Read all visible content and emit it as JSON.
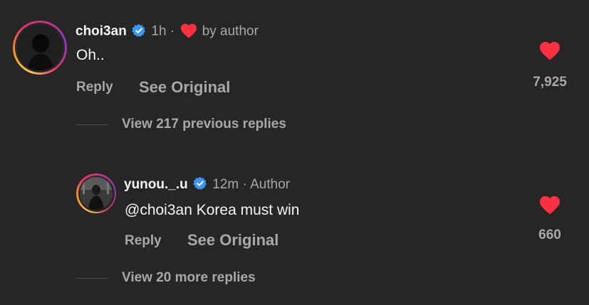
{
  "comment": {
    "username": "choi3an",
    "time": "1h",
    "separator": "·",
    "liked_by": "by author",
    "text": "Oh..",
    "reply_label": "Reply",
    "see_original_label": "See Original",
    "like_count": "7,925",
    "view_previous_label": "View 217 previous replies"
  },
  "reply": {
    "username": "yunou._.u",
    "time": "12m",
    "separator": "·",
    "badge": "Author",
    "mention": "@choi3an",
    "text": " Korea must win",
    "reply_label": "Reply",
    "see_original_label": "See Original",
    "like_count": "660",
    "view_more_label": "View 20 more replies"
  },
  "colors": {
    "background": "#262626",
    "verified_blue": "#3897f0",
    "heart_red": "#ff3040",
    "muted_text": "#a8a8a8"
  },
  "icons": [
    "verified-badge-icon",
    "heart-icon",
    "like-heart-icon"
  ]
}
